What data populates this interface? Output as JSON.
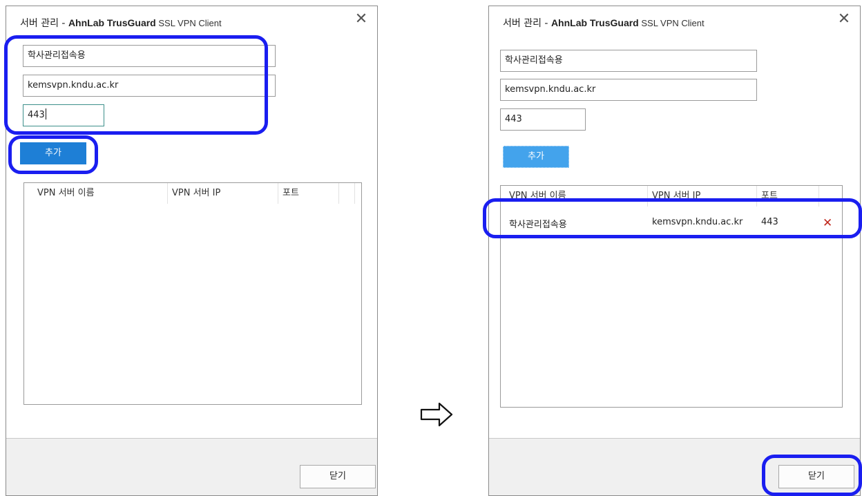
{
  "dialog": {
    "title_prefix": "서버 관리 - ",
    "brand": "AhnLab TrusGuard",
    "product": " SSL VPN Client",
    "close_glyph": "✕"
  },
  "form": {
    "name_value": "학사관리접속용",
    "address_value": "kemsvpn.kndu.ac.kr",
    "port_value": "443",
    "add_label": "추가"
  },
  "list": {
    "columns": [
      "VPN 서버 이름",
      "VPN 서버 IP",
      "포트"
    ],
    "rows": [
      {
        "name": "학사관리접속용",
        "ip": "kemsvpn.kndu.ac.kr",
        "port": "443",
        "delete_glyph": "✕"
      }
    ]
  },
  "footer": {
    "close_label": "닫기"
  },
  "icons": {
    "window_close": "close-icon",
    "delete": "delete-icon",
    "flow": "right-arrow-icon"
  },
  "colors": {
    "accent": "#1e7fd6",
    "highlight": "#1a1ef0",
    "delete": "#c0281d"
  }
}
